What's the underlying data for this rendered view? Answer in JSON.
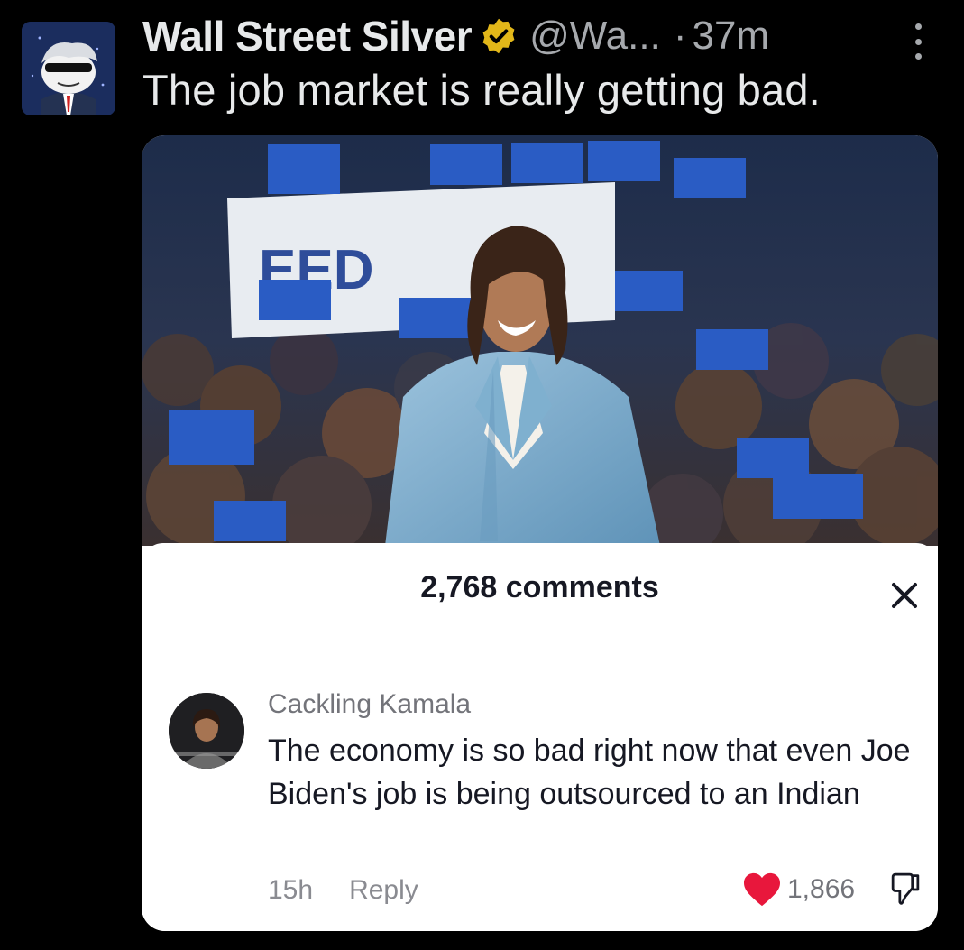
{
  "tweet": {
    "author_name": "Wall Street Silver",
    "handle": "@Wa...",
    "separator": "·",
    "time": "37m",
    "text": "The job market is really getting bad.",
    "avatar_icon": "cartoon-investor-avatar",
    "verified_icon": "verified-badge-icon",
    "verified_color": "#e2b719",
    "more_icon": "more-vertical-icon"
  },
  "media": {
    "photo_icon": "rally-photo",
    "sheet": {
      "comment_count": "2,768 comments",
      "close_icon": "close-icon",
      "comment": {
        "username": "Cackling Kamala",
        "text": "The economy is so bad right now that even Joe Biden's job is being outsourced to an Indian",
        "age": "15h",
        "reply_label": "Reply",
        "likes": "1,866",
        "like_color": "#e8173c",
        "like_icon": "heart-icon",
        "dislike_icon": "dislike-icon"
      }
    }
  }
}
